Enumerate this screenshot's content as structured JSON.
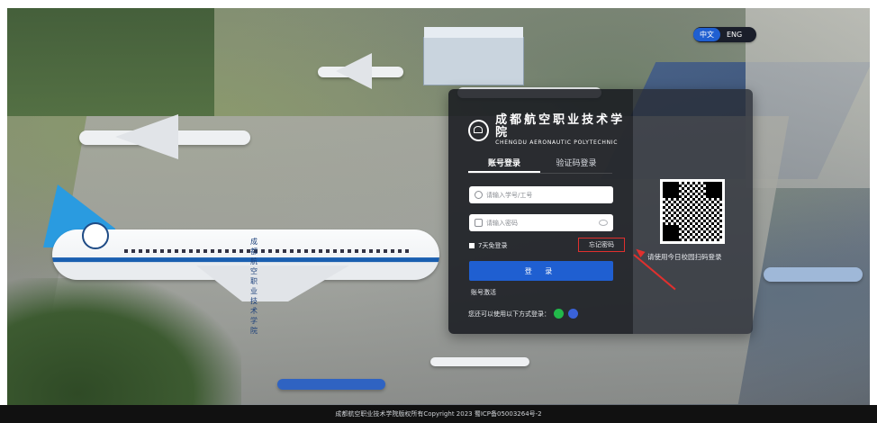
{
  "lang_toggle": {
    "zh": "中文",
    "en": "ENG"
  },
  "brand": {
    "name_cn": "成都航空职业技术学院",
    "name_en": "CHENGDU AERONAUTIC POLYTECHNIC"
  },
  "tabs": [
    {
      "label": "账号登录",
      "active": true
    },
    {
      "label": "验证码登录",
      "active": false
    }
  ],
  "form": {
    "username_placeholder": "请输入学号/工号",
    "password_placeholder": "请输入密码",
    "remember_label": "7天免登录",
    "forgot_label": "忘记密码",
    "login_label": "登 录",
    "activate_label": "账号激活",
    "other_login_label": "您还可以使用以下方式登录："
  },
  "qr": {
    "tip": "请使用今日校园扫码登录"
  },
  "background": {
    "plane_livery": "成都航空职业技术学院"
  },
  "footer": {
    "text": "成都航空职业技术学院版权所有Copyright 2023  蜀ICP备05003264号-2"
  },
  "colors": {
    "accent": "#1f5fd1",
    "highlight": "#e0302e"
  }
}
